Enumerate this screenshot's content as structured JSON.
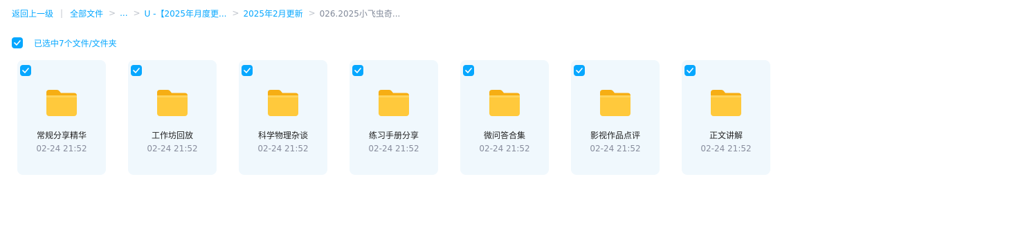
{
  "breadcrumb": {
    "back": "返回上一级",
    "all_files": "全部文件",
    "ellipsis": "...",
    "level1": "U -【2025年月度更...",
    "level2": "2025年2月更新",
    "current": "026.2025小飞虫奇..."
  },
  "selection": {
    "label": "已选中7个文件/文件夹"
  },
  "colors": {
    "accent": "#06a7ff",
    "card_bg": "#f0f8fd",
    "folder": "#ffc93c"
  },
  "folders": [
    {
      "name": "常规分享精华",
      "time": "02-24 21:52",
      "icon": "folder-icon",
      "checked": true
    },
    {
      "name": "工作坊回放",
      "time": "02-24 21:52",
      "icon": "folder-icon",
      "checked": true
    },
    {
      "name": "科学物理杂谈",
      "time": "02-24 21:52",
      "icon": "folder-icon",
      "checked": true
    },
    {
      "name": "练习手册分享",
      "time": "02-24 21:52",
      "icon": "folder-icon",
      "checked": true
    },
    {
      "name": "微问答合集",
      "time": "02-24 21:52",
      "icon": "folder-icon",
      "checked": true
    },
    {
      "name": "影视作品点评",
      "time": "02-24 21:52",
      "icon": "folder-icon",
      "checked": true
    },
    {
      "name": "正文讲解",
      "time": "02-24 21:52",
      "icon": "folder-icon",
      "checked": true
    }
  ]
}
